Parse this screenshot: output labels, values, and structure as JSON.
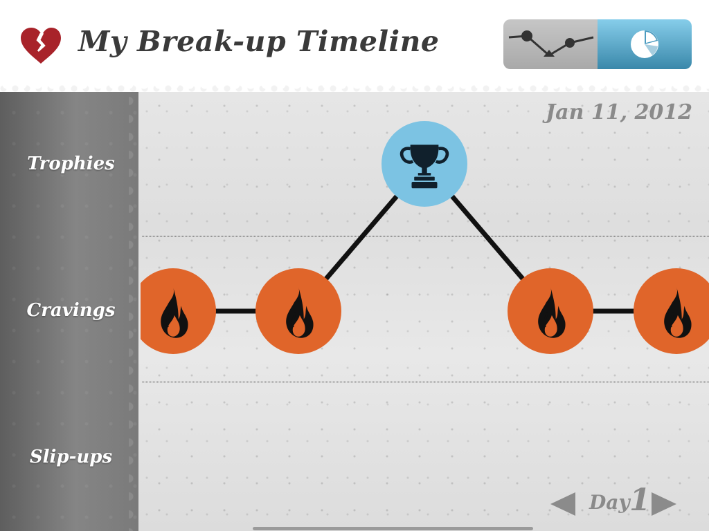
{
  "header": {
    "title": "My Break-up Timeline",
    "logo_icon": "broken-heart-icon",
    "view_switch": {
      "options": [
        {
          "id": "timeline",
          "icon": "line-graph-icon",
          "selected": true
        },
        {
          "id": "chart",
          "icon": "pie-chart-icon",
          "selected": false
        }
      ]
    }
  },
  "sidebar": {
    "rows": [
      {
        "label": "Trophies"
      },
      {
        "label": "Cravings"
      },
      {
        "label": "Slip-ups"
      }
    ]
  },
  "timeline": {
    "date": "Jan 11, 2012",
    "events": [
      {
        "type": "craving",
        "row": 1,
        "icon": "flame-icon"
      },
      {
        "type": "craving",
        "row": 1,
        "icon": "flame-icon"
      },
      {
        "type": "trophy",
        "row": 0,
        "icon": "trophy-icon"
      },
      {
        "type": "craving",
        "row": 1,
        "icon": "flame-icon"
      },
      {
        "type": "craving",
        "row": 1,
        "icon": "flame-icon"
      }
    ]
  },
  "pager": {
    "label": "Day",
    "day": "1"
  },
  "colors": {
    "craving": "#e0652a",
    "trophy": "#7cc3e3",
    "heart": "#a8232a",
    "chart_button": "#4d9cc0",
    "timeline_button": "#b8b8b8"
  }
}
